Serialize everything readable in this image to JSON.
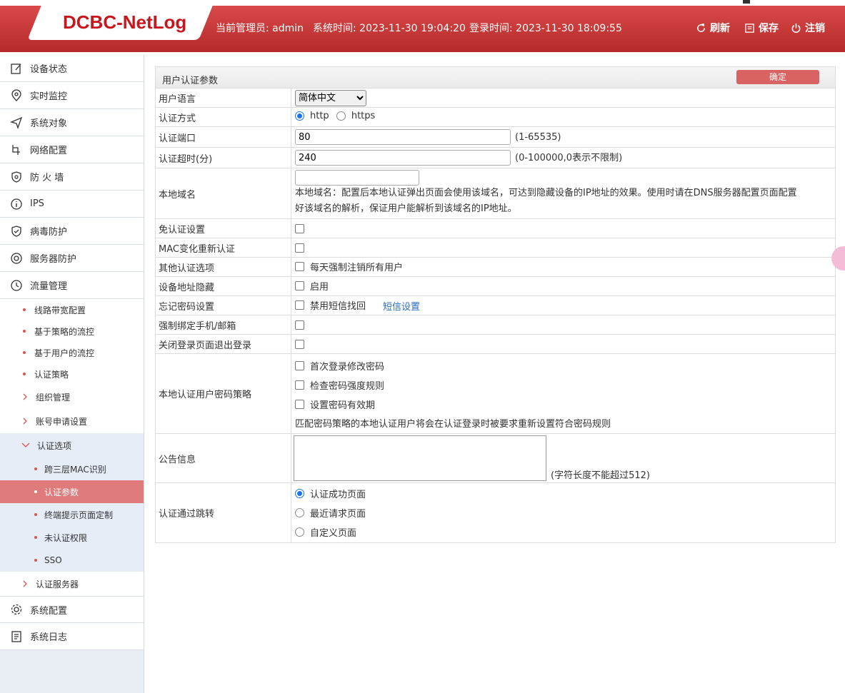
{
  "header": {
    "logo": "DCBC-NetLog",
    "admin_label": "当前管理员: admin",
    "system_time": "系统时间: 2023-11-30 19:04:20",
    "login_time": "登录时间: 2023-11-30 18:09:55",
    "refresh": "刷新",
    "save": "保存",
    "logout": "注销"
  },
  "sidebar": {
    "items": [
      {
        "label": "设备状态",
        "icon": "edit-icon"
      },
      {
        "label": "实时监控",
        "icon": "location-icon"
      },
      {
        "label": "系统对象",
        "icon": "send-icon"
      },
      {
        "label": "网络配置",
        "icon": "network-icon"
      },
      {
        "label": "防 火 墙",
        "icon": "shield-icon"
      },
      {
        "label": "IPS",
        "icon": "info-icon"
      },
      {
        "label": "病毒防护",
        "icon": "shield-check-icon"
      },
      {
        "label": "服务器防护",
        "icon": "target-icon"
      },
      {
        "label": "流量管理",
        "icon": "clock-icon"
      }
    ],
    "sub": [
      "线路带宽配置",
      "基于策略的流控",
      "基于用户的流控",
      "认证策略"
    ],
    "collapsed": [
      "组织管理",
      "账号申请设置"
    ],
    "auth_options": "认证选项",
    "auth_sub": [
      "跨三层MAC识别",
      "认证参数",
      "终端提示页面定制",
      "未认证权限",
      "SSO"
    ],
    "auth_server": "认证服务器",
    "bottom": [
      {
        "label": "系统配置",
        "icon": "gear-icon"
      },
      {
        "label": "系统日志",
        "icon": "log-icon"
      }
    ]
  },
  "panel": {
    "title": "用户认证参数",
    "confirm": "确定",
    "user_language": {
      "label": "用户语言",
      "value": "简体中文"
    },
    "auth_method": {
      "label": "认证方式",
      "http": "http",
      "https": "https"
    },
    "auth_port": {
      "label": "认证端口",
      "value": "80",
      "hint": "(1-65535)"
    },
    "auth_timeout": {
      "label": "认证超时(分)",
      "value": "240",
      "hint": "(0-100000,0表示不限制)"
    },
    "local_domain": {
      "label": "本地域名",
      "value": "",
      "desc1": "本地域名：配置后本地认证弹出页面会使用该域名，可达到隐藏设备的IP地址的效果。使用时请在DNS服务器配置页面配置",
      "desc2": "好该域名的解析，保证用户能解析到该域名的IP地址。"
    },
    "exempt_auth": {
      "label": "免认证设置"
    },
    "mac_reauth": {
      "label": "MAC变化重新认证"
    },
    "other_options": {
      "label": "其他认证选项",
      "option": "每天强制注销所有用户"
    },
    "hide_address": {
      "label": "设备地址隐藏",
      "option": "启用"
    },
    "forgot_password": {
      "label": "忘记密码设置",
      "option": "禁用短信找回",
      "link": "短信设置"
    },
    "force_bind": {
      "label": "强制绑定手机/邮箱"
    },
    "close_logout": {
      "label": "关闭登录页面退出登录"
    },
    "password_policy": {
      "label": "本地认证用户密码策略",
      "options": [
        "首次登录修改密码",
        "检查密码强度规则",
        "设置密码有效期"
      ],
      "note": "匹配密码策略的本地认证用户将会在认证登录时被要求重新设置符合密码规则"
    },
    "notice": {
      "label": "公告信息",
      "hint": "(字符长度不能超过512)"
    },
    "redirect": {
      "label": "认证通过跳转",
      "options": [
        "认证成功页面",
        "最近请求页面",
        "自定义页面"
      ]
    }
  }
}
